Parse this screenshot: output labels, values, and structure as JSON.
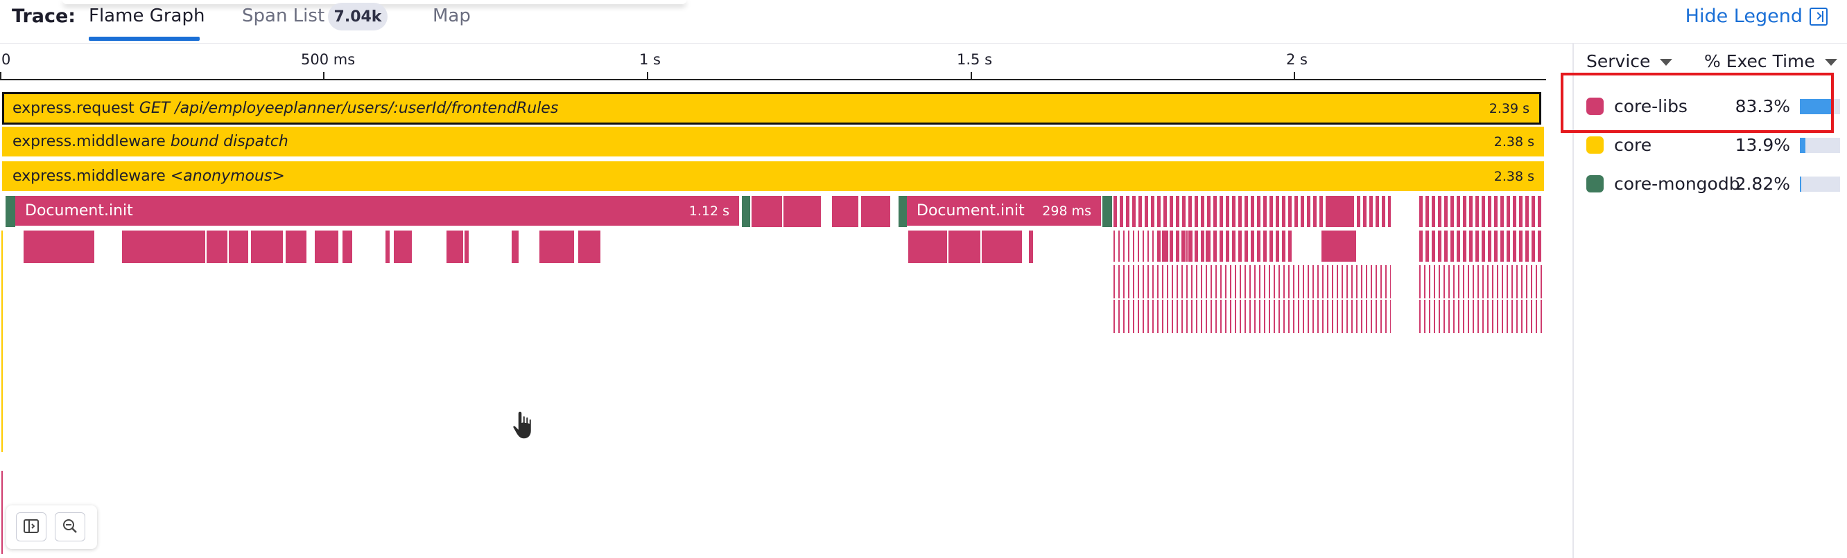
{
  "header": {
    "trace_label": "Trace:",
    "tabs": [
      {
        "label": "Flame Graph",
        "active": true
      },
      {
        "label": "Span List",
        "badge": "7.04k"
      },
      {
        "label": "Map"
      }
    ],
    "hide_legend": "Hide Legend"
  },
  "axis": {
    "ticks": [
      "0",
      "500 ms",
      "1 s",
      "1.5 s",
      "2 s"
    ]
  },
  "spans": {
    "request": {
      "op": "express.request",
      "resource": "GET /api/employeeplanner/users/:userId/frontendRules",
      "duration": "2.39 s"
    },
    "mw1": {
      "op": "express.middleware",
      "resource": "bound dispatch",
      "duration": "2.38 s"
    },
    "mw2": {
      "op": "express.middleware",
      "resource": "<anonymous>",
      "duration": "2.38 s"
    },
    "doc1": {
      "op": "Document.init",
      "duration": "1.12 s"
    },
    "doc2": {
      "op": "Document.init",
      "duration": "298 ms"
    }
  },
  "legend": {
    "service_header": "Service",
    "exec_header": "% Exec Time",
    "items": [
      {
        "service": "core-libs",
        "pct": "83.3%",
        "value": 0.833,
        "color": "#cf3c6e"
      },
      {
        "service": "core",
        "pct": "13.9%",
        "value": 0.139,
        "color": "#ffcc00"
      },
      {
        "service": "core-mongodb",
        "pct": "2.82%",
        "value": 0.0282,
        "color": "#3f7a5c"
      }
    ]
  },
  "colors": {
    "accent": "#1a6fd6",
    "core": "#ffcc00",
    "core_libs": "#cf3c6e",
    "core_mongodb": "#3f7a5c",
    "highlight": "#e5191e"
  }
}
